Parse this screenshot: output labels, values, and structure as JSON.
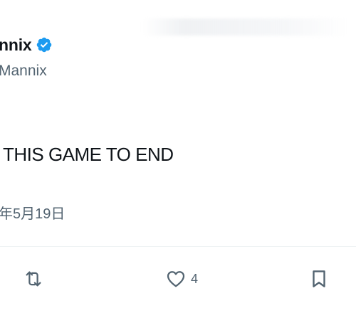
{
  "post": {
    "author": {
      "display_name": "nnix",
      "handle": "Mannix",
      "verified": true,
      "verified_icon": "verified-badge-icon",
      "verified_color": "#1d9bf0"
    },
    "text": "THIS GAME TO END",
    "timestamp": "年5月19日",
    "actions": {
      "retweet_icon": "retweet-icon",
      "like_icon": "heart-icon",
      "like_count": "4",
      "bookmark_icon": "bookmark-icon"
    }
  },
  "colors": {
    "text_primary": "#0f1419",
    "text_secondary": "#536471",
    "divider": "#eff3f4"
  }
}
